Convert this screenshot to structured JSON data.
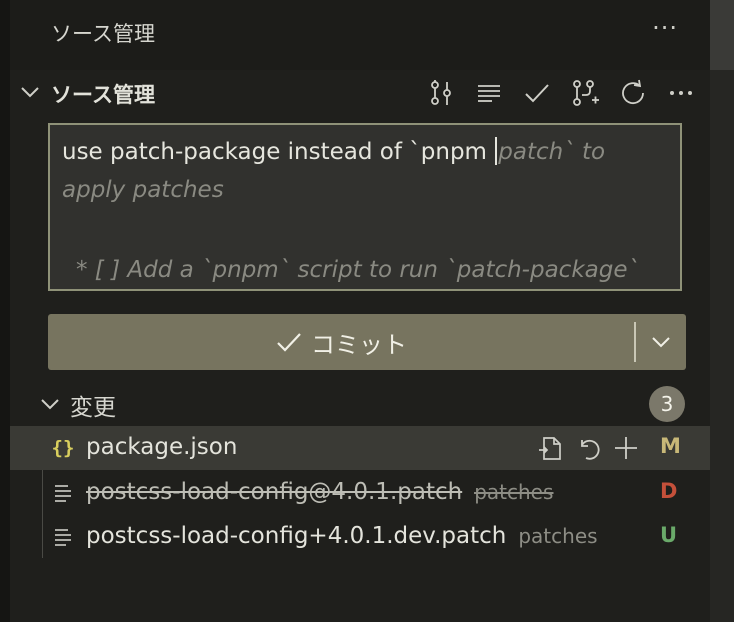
{
  "title_bar": {
    "title": "ソース管理",
    "more_icon": "ellipsis-icon"
  },
  "section": {
    "title": "ソース管理",
    "toolbar": [
      {
        "name": "view-as-tree-button",
        "icon": "graph-icon"
      },
      {
        "name": "view-as-list-button",
        "icon": "list-icon"
      },
      {
        "name": "commit-check-button",
        "icon": "check-icon"
      },
      {
        "name": "create-pull-request-button",
        "icon": "pull-request-icon"
      },
      {
        "name": "refresh-button",
        "icon": "refresh-icon"
      },
      {
        "name": "more-actions-button",
        "icon": "ellipsis-icon"
      }
    ]
  },
  "commit_message": {
    "typed": "use patch-package instead of `pnpm ",
    "placeholder_line1": "patch` to",
    "placeholder_line2": "apply patches",
    "placeholder_line3": "* [ ]  Add a `pnpm` script to run `patch-package`"
  },
  "commit_button": {
    "label": "コミット"
  },
  "changes": {
    "title": "変更",
    "count": "3",
    "files": [
      {
        "name": "package.json",
        "dir": "",
        "status": "M",
        "status_color": "#c8b878",
        "icon": "json-icon",
        "selected": true,
        "deleted": false
      },
      {
        "name": "postcss-load-config@4.0.1.patch",
        "dir": "patches",
        "status": "D",
        "status_color": "#c4503a",
        "icon": "text-file-icon",
        "selected": false,
        "deleted": true
      },
      {
        "name": "postcss-load-config+4.0.1.dev.patch",
        "dir": "patches",
        "status": "U",
        "status_color": "#6aaa6a",
        "icon": "text-file-icon",
        "selected": false,
        "deleted": false
      }
    ]
  },
  "colors": {
    "accent": "#77745f",
    "panel_bg": "#1f1f1c",
    "input_border": "#8f9278"
  }
}
